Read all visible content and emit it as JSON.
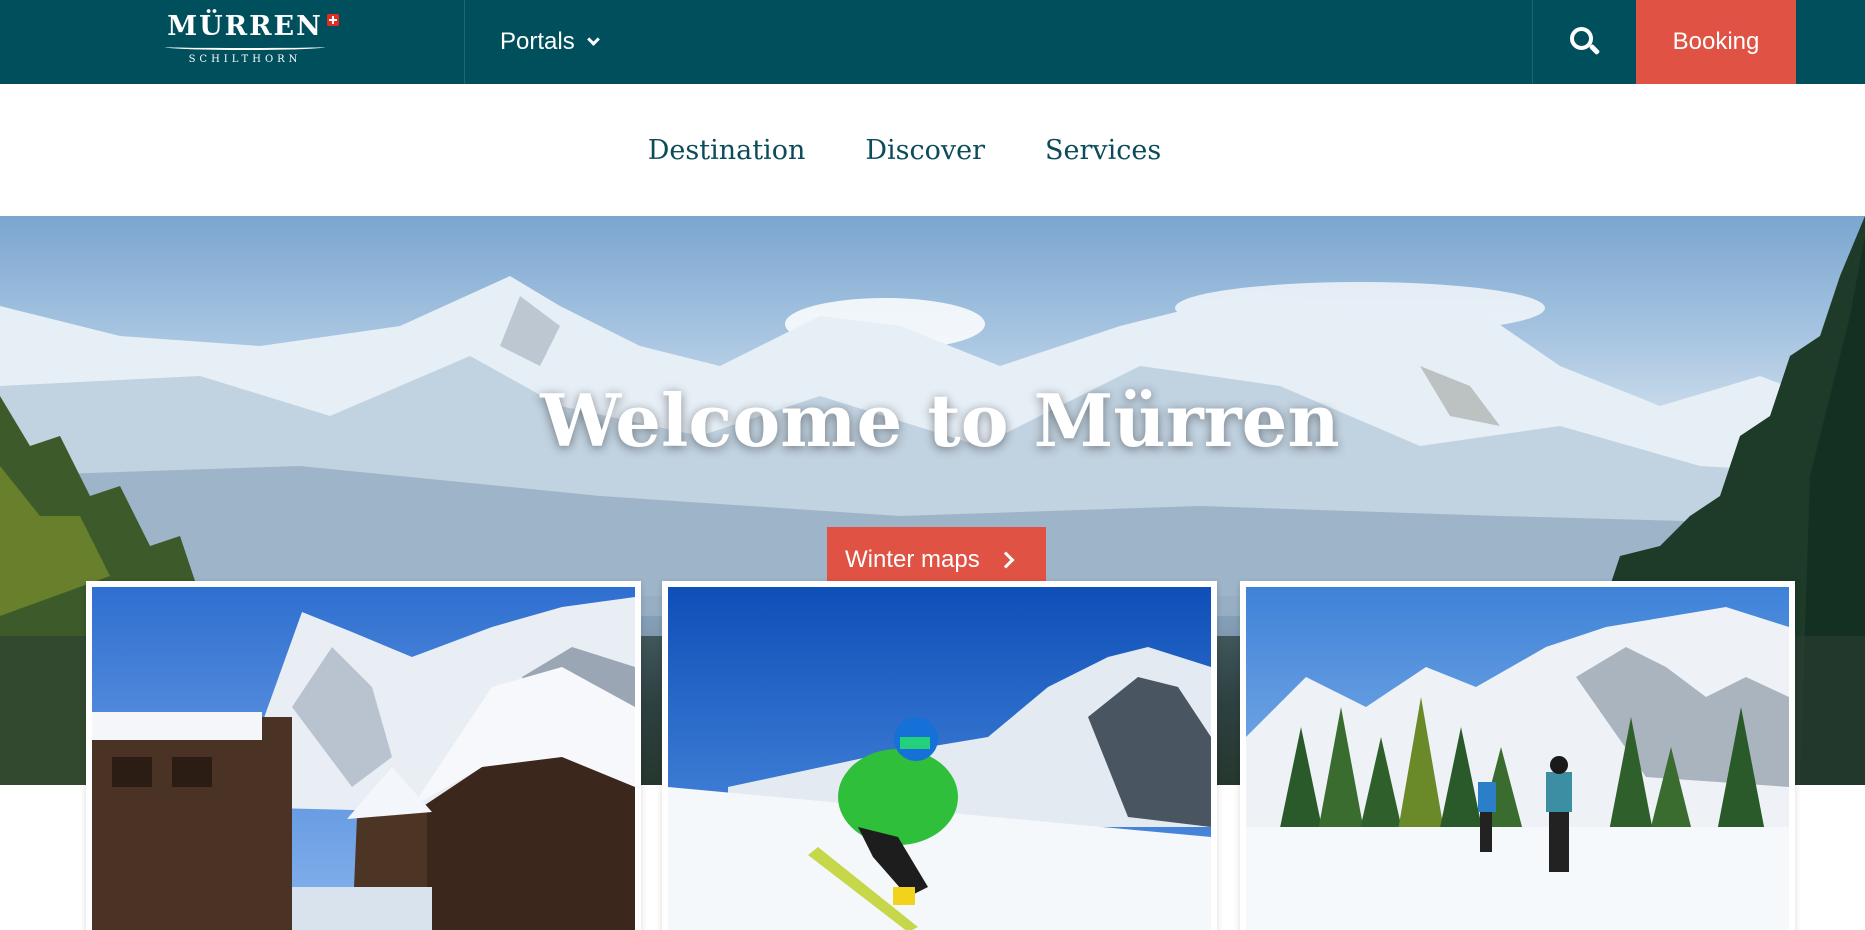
{
  "header": {
    "logo": {
      "name": "MÜRREN",
      "sub": "SCHILTHORN"
    },
    "portals_label": "Portals",
    "search_icon": "search-icon",
    "booking_label": "Booking"
  },
  "nav": {
    "items": [
      {
        "label": "Destination"
      },
      {
        "label": "Discover"
      },
      {
        "label": "Services"
      }
    ]
  },
  "hero": {
    "title": "Welcome to Mürren",
    "cta_label": "Winter maps"
  },
  "cards": [
    {
      "image": "snowy chalets in Mürren village"
    },
    {
      "image": "skier in green jacket carving down a slope"
    },
    {
      "image": "two snowshoe hikers in a forest"
    }
  ],
  "colors": {
    "brand_teal": "#004f5d",
    "accent_red": "#e05243",
    "nav_text": "#0b4b5a"
  }
}
